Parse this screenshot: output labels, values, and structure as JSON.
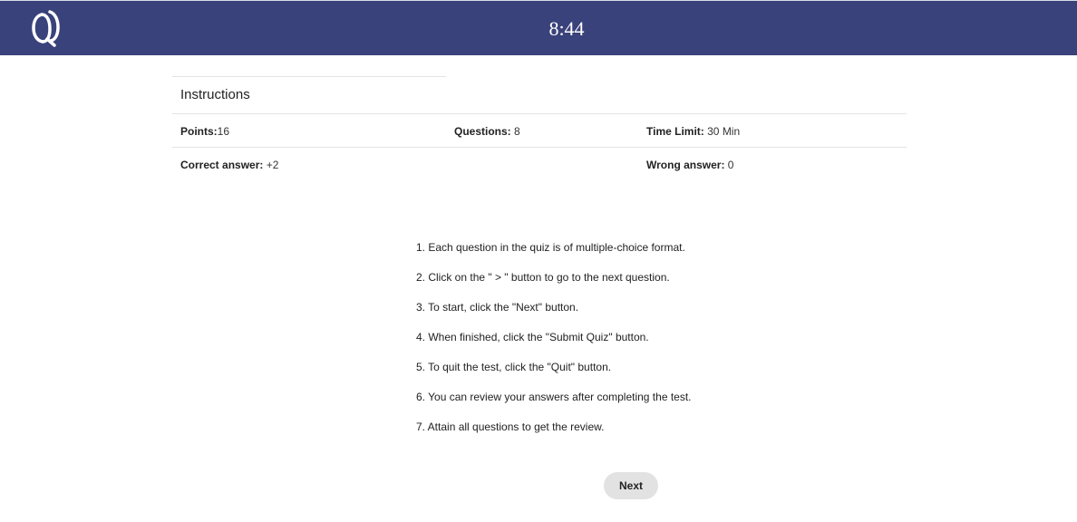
{
  "header": {
    "logo_icon": "quiz-q-logo-icon",
    "timer": "8:44",
    "background_color": "#39427a"
  },
  "instructions": {
    "title": "Instructions",
    "points_label": "Points:",
    "points_value": "16",
    "questions_label": "Questions:",
    "questions_value": " 8",
    "time_limit_label": "Time Limit:",
    "time_limit_value": " 30 Min",
    "correct_label": "Correct answer:",
    "correct_value": " +2",
    "wrong_label": "Wrong answer:",
    "wrong_value": " 0"
  },
  "rules": [
    "1. Each question in the quiz is of multiple-choice format.",
    "2. Click on the \" > \" button to go to the next question.",
    "3. To start, click the \"Next\" button.",
    "4. When finished, click the \"Submit Quiz\" button.",
    "5. To quit the test, click the \"Quit\" button.",
    "6. You can review your answers after completing the test.",
    "7. Attain all questions to get the review."
  ],
  "actions": {
    "next_label": "Next"
  }
}
